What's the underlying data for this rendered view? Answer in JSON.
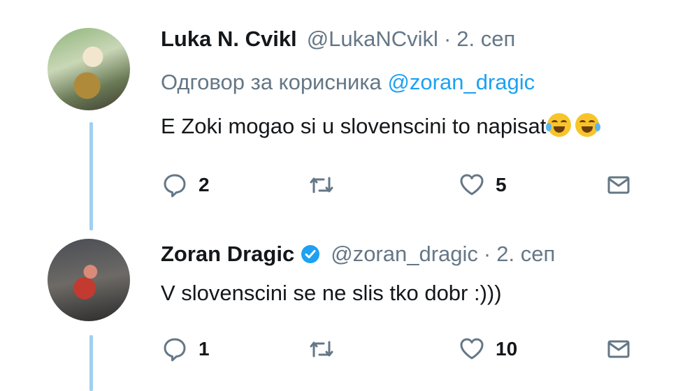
{
  "tweets": [
    {
      "name": "Luka N. Cvikl",
      "handle": "@LukaNCvikl",
      "date": "2. сеп",
      "reply_label": "Одговор за корисника",
      "reply_mention": "@zoran_dragic",
      "text": "E Zoki mogao si u slovenscini to napisat",
      "emoji": [
        "face-with-tears-of-joy",
        "face-with-tears-of-joy"
      ],
      "replies": "2",
      "likes": "5",
      "verified": false
    },
    {
      "name": "Zoran Dragic",
      "handle": "@zoran_dragic",
      "date": "2. сеп",
      "text": "V slovenscini se ne slis tko dobr :)))",
      "replies": "1",
      "likes": "10",
      "verified": true
    }
  ],
  "separator": "·",
  "colors": {
    "thread_line": "#9fd0f0",
    "link": "#1da1f2",
    "muted": "#657786",
    "verified": "#1da1f2"
  }
}
